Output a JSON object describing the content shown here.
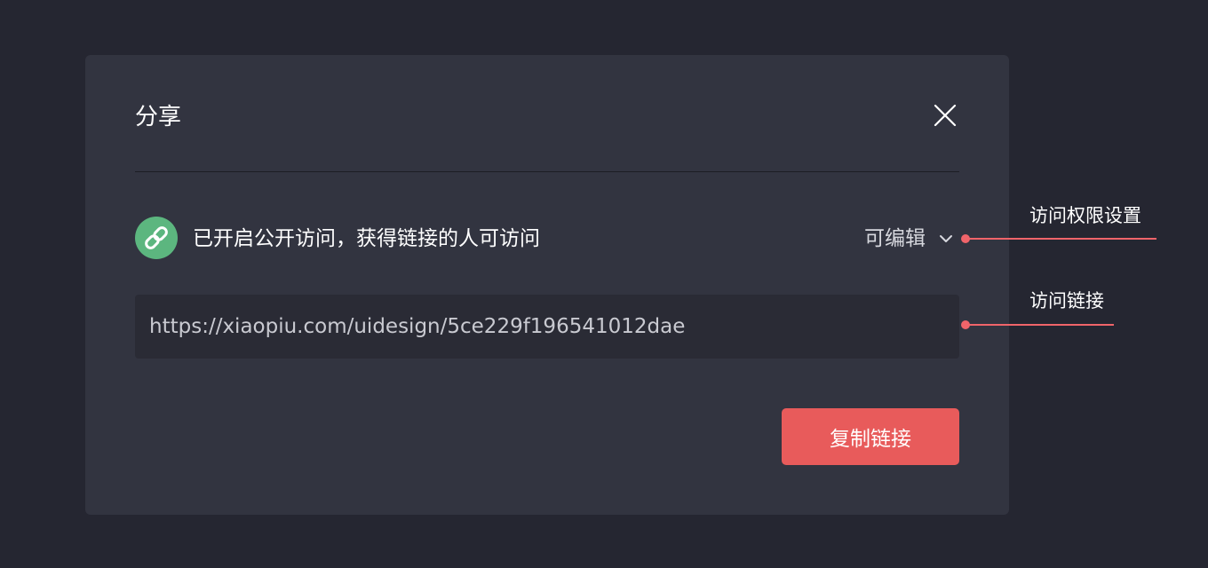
{
  "dialog": {
    "title": "分享",
    "close_icon": "close-icon",
    "status": {
      "icon": "link-icon",
      "text": "已开启公开访问，获得链接的人可访问"
    },
    "permission": {
      "selected": "可编辑",
      "icon": "chevron-down-icon"
    },
    "url_field": {
      "value": "https://xiaopiu.com/uidesign/5ce229f196541012dae"
    },
    "copy_button": {
      "label": "复制链接"
    }
  },
  "annotations": [
    {
      "label": "访问权限设置"
    },
    {
      "label": "访问链接"
    }
  ],
  "colors": {
    "page_background": "#252631",
    "dialog_background": "#323440",
    "input_background": "#2a2b35",
    "link_badge": "#5cb67f",
    "primary_button": "#e85b5b",
    "annotation": "#f0646a"
  }
}
